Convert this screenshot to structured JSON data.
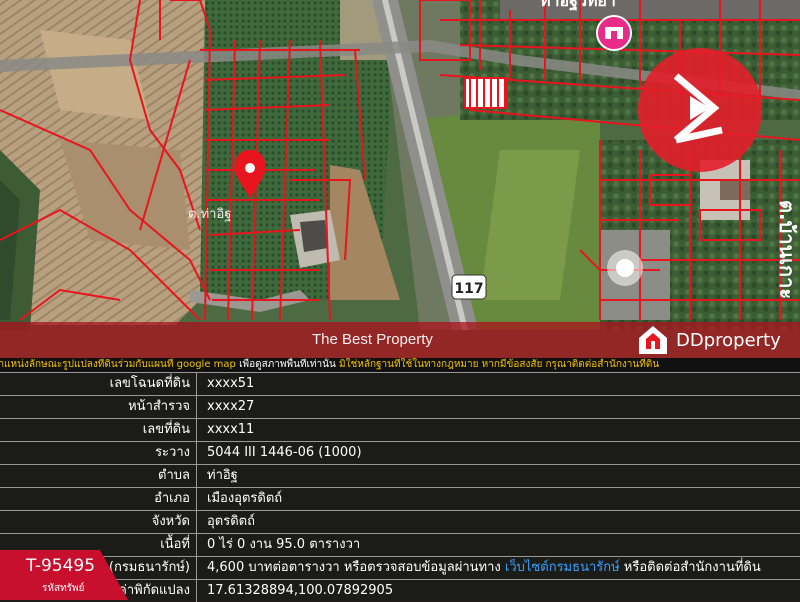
{
  "map": {
    "place_label": "ต.ท่าอิฐ",
    "place_label_2": "ต.บ้านเกาะ",
    "highway_shield": "117",
    "school_label": "ท่าอิฐวิทยา",
    "colors": {
      "parcel_line": "#e8141e",
      "pin": "#e8141e",
      "field": "#b99d7c",
      "vegetation": "#3d5e35",
      "road": "#8a8a88"
    },
    "icons": [
      "location-pin-icon",
      "school-icon",
      "highway-shield-icon"
    ]
  },
  "brand": {
    "logo_icon": "bp-logo-icon"
  },
  "ddproperty": {
    "label": "DDproperty",
    "icon": "ddproperty-house-icon"
  },
  "watermark": {
    "text": "The Best Property"
  },
  "notice": {
    "prefix": "ตำแหน่งลักษณะรูปแปลงที่ดินร่วมกับแผนที่ google map ",
    "middle": "เพื่อดูสภาพพื้นที่เท่านั้น ",
    "suffix": "มิใช่หลักฐานที่ใช้ในทางกฎหมาย หากมีข้อสงสัย กรุณาติดต่อสำนักงานที่ดิน"
  },
  "table": {
    "rows": [
      {
        "label": "เลขโฉนดที่ดิน",
        "value": "xxxx51"
      },
      {
        "label": "หน้าสำรวจ",
        "value": "xxxx27"
      },
      {
        "label": "เลขที่ดิน",
        "value": "xxxx11"
      },
      {
        "label": "ระวาง",
        "value": "5044 III 1446-06 (1000)"
      },
      {
        "label": "ตำบล",
        "value": "ท่าอิฐ"
      },
      {
        "label": "อำเภอ",
        "value": "เมืองอุตรดิตถ์"
      },
      {
        "label": "จังหวัด",
        "value": "อุตรดิตถ์"
      },
      {
        "label": "เนื้อที่",
        "value": "0 ไร่ 0 งาน 95.0 ตารางวา"
      },
      {
        "label": "ราคาประเมิน (กรมธนารักษ์)",
        "value": "4,600 บาทต่อตารางวา หรือตรวจสอบข้อมูลผ่านทาง ",
        "link": "เว็บไซต์กรมธนารักษ์",
        "value_suffix": " หรือติดต่อสำนักงานที่ดิน"
      },
      {
        "label": "ค่าพิกัดแปลง",
        "value": "17.61328894,100.07892905"
      }
    ]
  },
  "listing": {
    "code": "T-95495",
    "code_label": "รหัสทรัพย์"
  }
}
